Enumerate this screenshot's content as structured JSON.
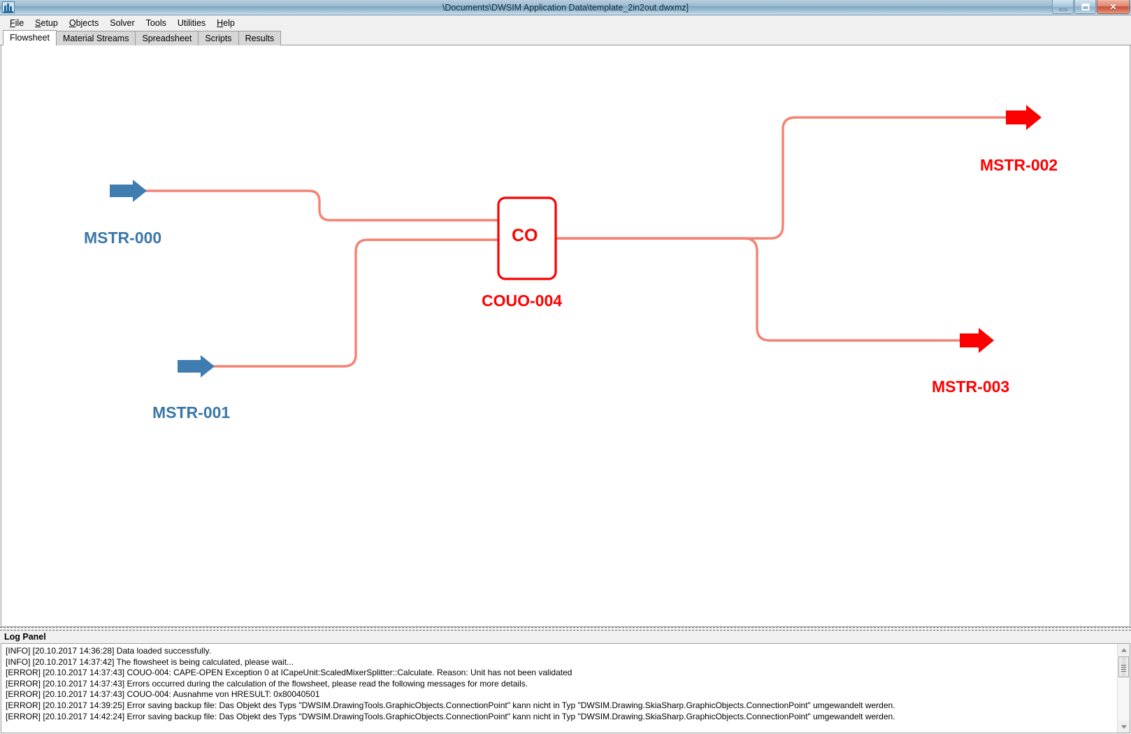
{
  "window": {
    "title": "\\Documents\\DWSIM Application Data\\template_2in2out.dwxmz]",
    "app_icon": "dwsim-app-icon",
    "minimize_label": "",
    "maximize_label": "",
    "close_label": "✕"
  },
  "menu": {
    "items": [
      {
        "label": "File"
      },
      {
        "label": "Setup"
      },
      {
        "label": "Objects"
      },
      {
        "label": "Solver"
      },
      {
        "label": "Tools"
      },
      {
        "label": "Utilities"
      },
      {
        "label": "Help"
      }
    ]
  },
  "tabs": {
    "items": [
      {
        "label": "Flowsheet",
        "active": true
      },
      {
        "label": "Material Streams",
        "active": false
      },
      {
        "label": "Spreadsheet",
        "active": false
      },
      {
        "label": "Scripts",
        "active": false
      },
      {
        "label": "Results",
        "active": false
      }
    ]
  },
  "flowsheet": {
    "colors": {
      "stream_line": "#f58273",
      "inlet_arrow": "#3f7caf",
      "outlet_arrow": "#fb0000",
      "unit_border": "#fb0000",
      "inlet_label": "#3b77a8",
      "outlet_label": "#ff0000"
    },
    "unit": {
      "symbol_text": "CO",
      "name": "COUO-004"
    },
    "inlet_streams": [
      {
        "name": "MSTR-000"
      },
      {
        "name": "MSTR-001"
      }
    ],
    "outlet_streams": [
      {
        "name": "MSTR-002"
      },
      {
        "name": "MSTR-003"
      }
    ]
  },
  "log_panel": {
    "title": "Log Panel",
    "lines": [
      "[INFO] [20.10.2017 14:36:28] Data loaded successfully.",
      "[INFO] [20.10.2017 14:37:42] The flowsheet is being calculated, please wait...",
      "[ERROR] [20.10.2017 14:37:43] COUO-004: CAPE-OPEN Exception 0 at ICapeUnit:ScaledMixerSplitter::Calculate. Reason: Unit has not been validated",
      "[ERROR] [20.10.2017 14:37:43] Errors occurred during the calculation of the flowsheet, please read the following messages for more details.",
      "[ERROR] [20.10.2017 14:37:43] COUO-004: Ausnahme von HRESULT: 0x80040501",
      "[ERROR] [20.10.2017 14:39:25] Error saving backup file: Das Objekt des Typs \"DWSIM.DrawingTools.GraphicObjects.ConnectionPoint\" kann nicht in Typ \"DWSIM.Drawing.SkiaSharp.GraphicObjects.ConnectionPoint\" umgewandelt werden.",
      "[ERROR] [20.10.2017 14:42:24] Error saving backup file: Das Objekt des Typs \"DWSIM.DrawingTools.GraphicObjects.ConnectionPoint\" kann nicht in Typ \"DWSIM.Drawing.SkiaSharp.GraphicObjects.ConnectionPoint\" umgewandelt werden."
    ],
    "scrollbar": {
      "up_icon": "scroll-up-arrow-icon",
      "down_icon": "scroll-down-arrow-icon"
    }
  }
}
